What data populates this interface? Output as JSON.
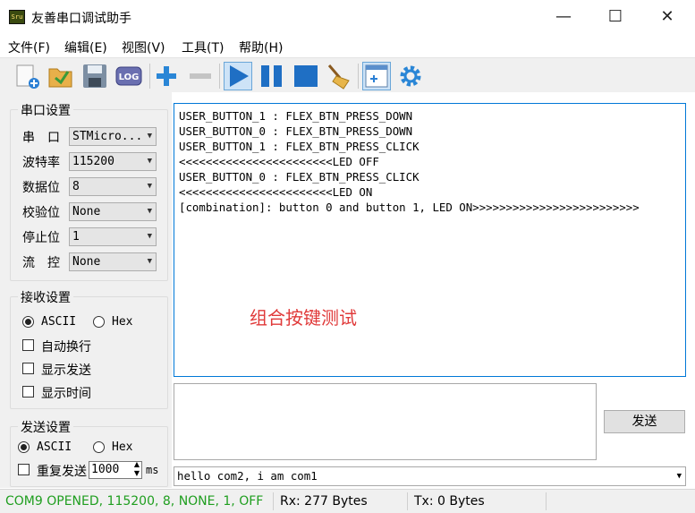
{
  "window": {
    "title": "友善串口调试助手",
    "icon_text": "Sru",
    "minimize": "—",
    "maximize": "☐",
    "close": "✕"
  },
  "menu": [
    "文件(F)",
    "编辑(E)",
    "视图(V)",
    "工具(T)",
    "帮助(H)"
  ],
  "toolbar": {
    "log_label": "LOG"
  },
  "serial_settings": {
    "title": "串口设置",
    "port": {
      "label": "串　口",
      "value": "STMicro..."
    },
    "baud": {
      "label": "波特率",
      "value": "115200"
    },
    "databits": {
      "label": "数据位",
      "value": "8"
    },
    "parity": {
      "label": "校验位",
      "value": "None"
    },
    "stopbits": {
      "label": "停止位",
      "value": "1"
    },
    "flow": {
      "label": "流　控",
      "value": "None"
    }
  },
  "receive_settings": {
    "title": "接收设置",
    "ascii": "ASCII",
    "hex": "Hex",
    "auto_newline": "自动换行",
    "show_sent": "显示发送",
    "show_time": "显示时间"
  },
  "send_settings": {
    "title": "发送设置",
    "ascii": "ASCII",
    "hex": "Hex",
    "repeat": "重复发送",
    "interval": "1000",
    "unit": "ms"
  },
  "receive_lines": [
    "USER_BUTTON_1 : FLEX_BTN_PRESS_DOWN",
    "USER_BUTTON_0 : FLEX_BTN_PRESS_DOWN",
    "USER_BUTTON_1 : FLEX_BTN_PRESS_CLICK",
    "<<<<<<<<<<<<<<<<<<<<<<<LED OFF",
    "USER_BUTTON_0 : FLEX_BTN_PRESS_CLICK",
    "<<<<<<<<<<<<<<<<<<<<<<<LED ON",
    "[combination]: button 0 and button 1, LED ON>>>>>>>>>>>>>>>>>>>>>>>>>"
  ],
  "overlay_caption": "组合按键测试",
  "send_button": "发送",
  "send_history": "hello com2, i am com1",
  "status": {
    "port": "COM9 OPENED, 115200, 8, NONE, 1, OFF",
    "rx": "Rx: 277 Bytes",
    "tx": "Tx: 0 Bytes",
    "port_color": "#1f9e1f"
  }
}
